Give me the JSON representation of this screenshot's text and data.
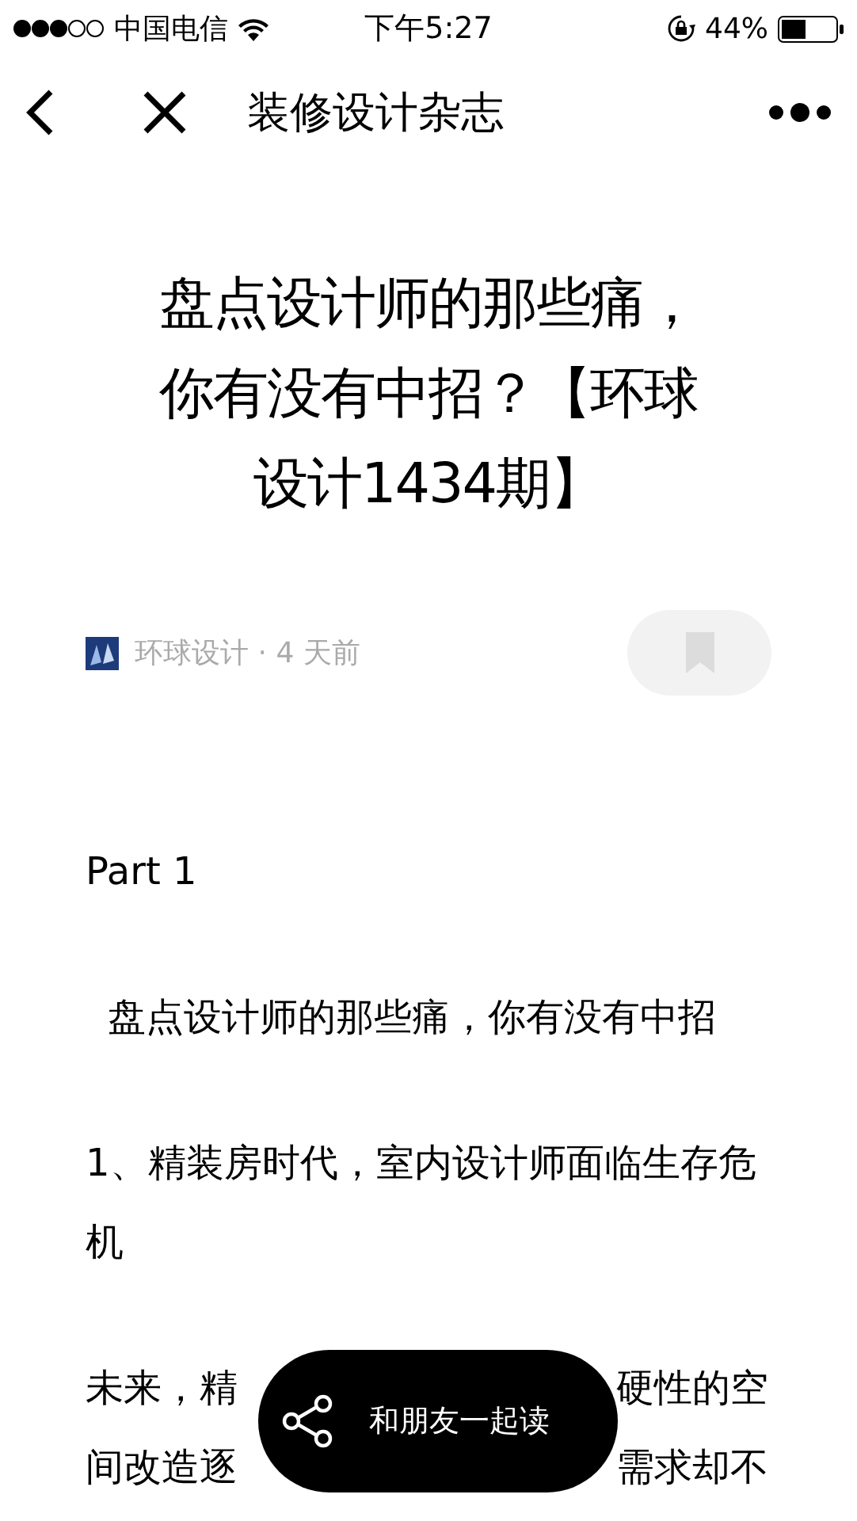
{
  "status_bar": {
    "carrier": "中国电信",
    "time": "下午5:27",
    "battery": "44%"
  },
  "nav_bar": {
    "title": "装修设计杂志"
  },
  "article": {
    "title_lines": [
      "盘点设计师的那些痛，",
      "你有没有中招？【环球",
      "设计1434期】"
    ],
    "author": "环球设计",
    "separator": "·",
    "time": "4 天前",
    "paragraphs": [
      {
        "kind": "text",
        "text": "Part 1"
      },
      {
        "kind": "indent",
        "text": "盘点设计师的那些痛，你有没有中招"
      },
      {
        "kind": "text",
        "text": "1、精装房时代，室内设计师面临生存危机"
      },
      {
        "kind": "split",
        "lines": [
          [
            "未来，精",
            "硬性的空"
          ],
          [
            "间改造逐",
            "需求却不"
          ]
        ]
      }
    ]
  },
  "share_button": {
    "label": "和朋友一起读"
  }
}
